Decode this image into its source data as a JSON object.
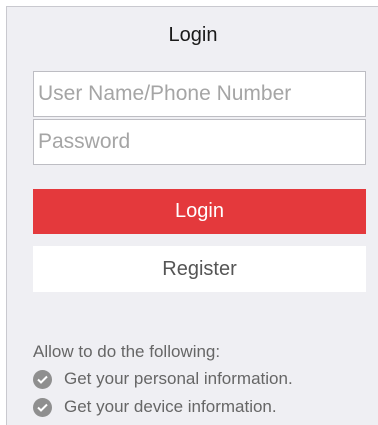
{
  "login": {
    "title": "Login",
    "username_placeholder": "User Name/Phone Number",
    "password_placeholder": "Password",
    "login_button": "Login",
    "register_button": "Register"
  },
  "permissions": {
    "heading": "Allow to do the following:",
    "items": [
      {
        "label": "Get your personal information.",
        "icon": "check-circle-icon"
      },
      {
        "label": "Get your device information.",
        "icon": "check-circle-icon"
      }
    ]
  },
  "colors": {
    "accent": "#e4393c",
    "panel_background": "#efeff3"
  }
}
